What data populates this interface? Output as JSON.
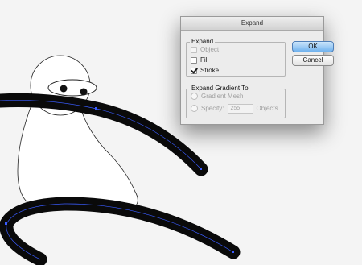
{
  "dialog": {
    "title": "Expand",
    "expand_group": {
      "title": "Expand",
      "options": [
        {
          "label": "Object",
          "checked": false,
          "enabled": false
        },
        {
          "label": "Fill",
          "checked": false,
          "enabled": true
        },
        {
          "label": "Stroke",
          "checked": true,
          "enabled": true
        }
      ]
    },
    "gradient_group": {
      "title": "Expand Gradient To",
      "gradient_mesh_label": "Gradient Mesh",
      "specify_label": "Specify:",
      "specify_value": "255",
      "objects_label": "Objects"
    },
    "ok_label": "OK",
    "cancel_label": "Cancel"
  },
  "colors": {
    "stroke": "#0a0a0a",
    "path_highlight": "#3a5cff",
    "figure_fill": "#ffffff",
    "ok_button": "#6fb2ee"
  }
}
